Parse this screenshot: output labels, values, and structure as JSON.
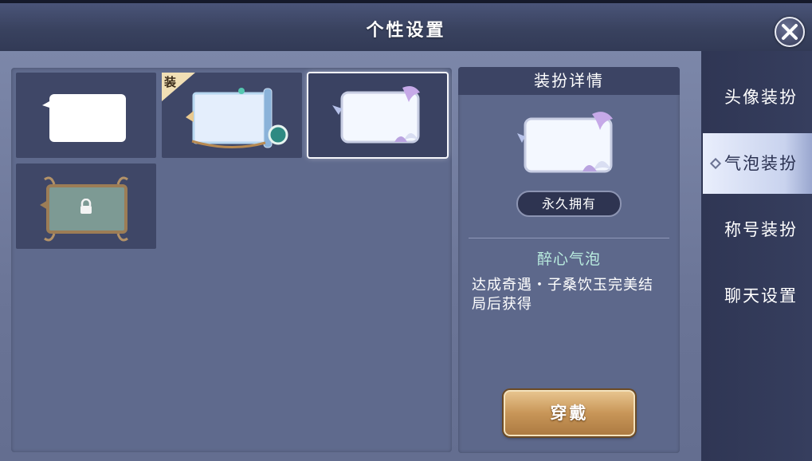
{
  "header": {
    "title": "个性设置",
    "close_icon": "close-icon"
  },
  "grid": {
    "slots": [
      {
        "name": "bubble-default",
        "equipped": false,
        "locked": false,
        "selected": false
      },
      {
        "name": "bubble-scroll",
        "equipped": true,
        "equip_label": "装",
        "locked": false,
        "selected": false
      },
      {
        "name": "bubble-lotus",
        "equipped": false,
        "locked": false,
        "selected": true
      },
      {
        "name": "bubble-dragon",
        "equipped": false,
        "locked": true,
        "selected": false
      }
    ]
  },
  "detail": {
    "header": "装扮详情",
    "owned": "永久拥有",
    "item_name": "醉心气泡",
    "description": "达成奇遇・子桑饮玉完美结局后获得",
    "wear_button": "穿戴"
  },
  "sidebar": {
    "tabs": [
      {
        "label": "头像装扮",
        "active": false
      },
      {
        "label": "气泡装扮",
        "active": true
      },
      {
        "label": "称号装扮",
        "active": false
      },
      {
        "label": "聊天设置",
        "active": false
      }
    ]
  },
  "colors": {
    "accent_item_name": "#b9ecdf",
    "button_gold": "#c89658",
    "panel": "#5f6a8d",
    "slot_bg": "#3f4767"
  }
}
